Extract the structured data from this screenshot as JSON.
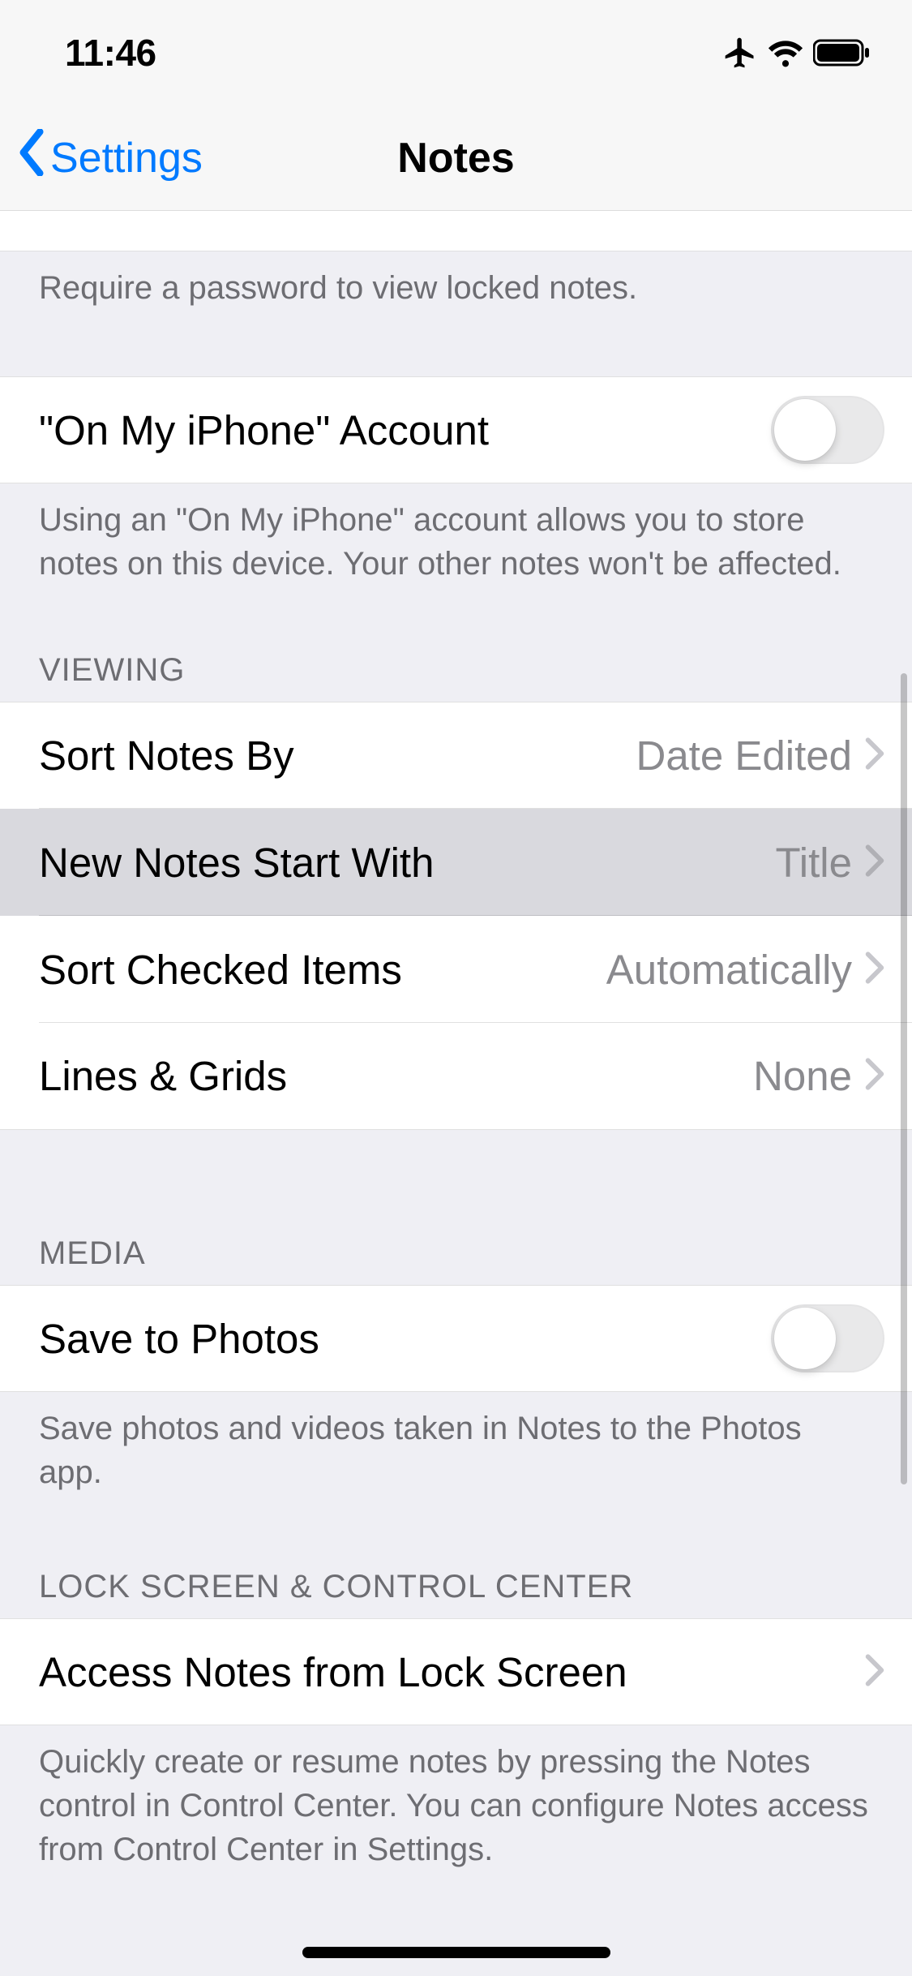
{
  "status": {
    "time": "11:46"
  },
  "nav": {
    "back_label": "Settings",
    "title": "Notes"
  },
  "password_footer": "Require a password to view locked notes.",
  "on_my_iphone": {
    "label": "\"On My iPhone\" Account",
    "footer": "Using an \"On My iPhone\" account allows you to store notes on this device. Your other notes won't be affected."
  },
  "viewing": {
    "header": "VIEWING",
    "sort_notes_label": "Sort Notes By",
    "sort_notes_value": "Date Edited",
    "new_notes_label": "New Notes Start With",
    "new_notes_value": "Title",
    "sort_checked_label": "Sort Checked Items",
    "sort_checked_value": "Automatically",
    "lines_grids_label": "Lines & Grids",
    "lines_grids_value": "None"
  },
  "media": {
    "header": "MEDIA",
    "save_photos_label": "Save to Photos",
    "footer": "Save photos and videos taken in Notes to the Photos app."
  },
  "lock_screen": {
    "header": "LOCK SCREEN & CONTROL CENTER",
    "access_label": "Access Notes from Lock Screen",
    "footer": "Quickly create or resume notes by pressing the Notes control in Control Center. You can configure Notes access from Control Center in Settings."
  }
}
